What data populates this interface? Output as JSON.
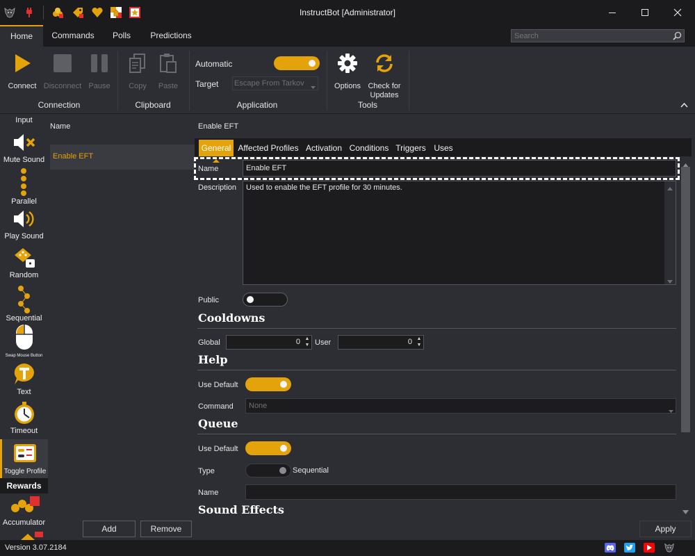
{
  "window": {
    "title": "InstructBot [Administrator]",
    "quick_access_icons": [
      "wolf-logo-icon",
      "plug-icon",
      "coins-icon",
      "tag-icon",
      "heart-icon",
      "chess-icon",
      "star-icon"
    ],
    "controls": [
      "minimize-icon",
      "maximize-icon",
      "close-icon"
    ]
  },
  "ribbon_tabs": [
    "Home",
    "Commands",
    "Polls",
    "Predictions"
  ],
  "active_tab": "Home",
  "search": {
    "placeholder": "Search"
  },
  "ribbon": {
    "connection": {
      "label": "Connection",
      "connect": "Connect",
      "disconnect": "Disconnect",
      "pause": "Pause"
    },
    "clipboard": {
      "label": "Clipboard",
      "copy": "Copy",
      "paste": "Paste"
    },
    "application": {
      "label": "Application",
      "automatic": "Automatic",
      "target_label": "Target",
      "target_value": "Escape From Tarkov",
      "automatic_on": true
    },
    "tools": {
      "label": "Tools",
      "options": "Options",
      "check_updates": "Check for Updates"
    }
  },
  "toolbox": {
    "input_label": "Input",
    "items": [
      "Mute Sound",
      "Parallel",
      "Play Sound",
      "Random",
      "Sequential",
      "Swap Mouse Button",
      "Text",
      "Timeout",
      "Toggle Profile"
    ],
    "rewards_header": "Rewards",
    "rewards_items": [
      "Accumulator"
    ]
  },
  "list": {
    "header": "Name",
    "items": [
      "Enable EFT"
    ],
    "add": "Add",
    "remove": "Remove"
  },
  "detail": {
    "title": "Enable EFT",
    "tabs": [
      "General",
      "Affected Profiles",
      "Activation",
      "Conditions",
      "Triggers",
      "Uses"
    ],
    "active_tab": "General",
    "name_label": "Name",
    "name_value": "Enable EFT",
    "description_label": "Description",
    "description_value": "Used to enable the EFT profile for 30 minutes.",
    "public_label": "Public",
    "public_on": false,
    "cooldowns": {
      "header": "Cooldowns",
      "global_label": "Global",
      "global_value": "0",
      "user_label": "User",
      "user_value": "0"
    },
    "help": {
      "header": "Help",
      "use_default_label": "Use Default",
      "use_default_on": true,
      "command_label": "Command",
      "command_value": "None"
    },
    "queue": {
      "header": "Queue",
      "use_default_label": "Use Default",
      "use_default_on": true,
      "type_label": "Type",
      "type_value": "Sequential",
      "name_label": "Name",
      "name_value": ""
    },
    "sound_effects_header": "Sound Effects",
    "apply": "Apply"
  },
  "status": {
    "version": "Version 3.07.2184",
    "icons": [
      "discord-icon",
      "twitter-icon",
      "youtube-icon",
      "wolf-logo-icon"
    ]
  },
  "colors": {
    "accent": "#e4a30a",
    "background": "#2d2e33",
    "dark": "#1b1b1e",
    "field": "#1c1c1f"
  },
  "chart_data": null
}
